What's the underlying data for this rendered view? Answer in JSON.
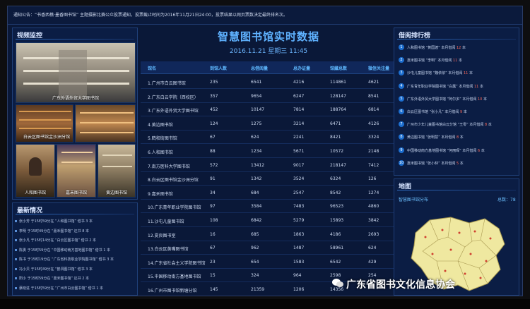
{
  "ticker": "通知公告：“书香西樵·墨香图书馆” 主题摄影比赛公众投票通知，投票截止时间为2016年11月21日24:00，投票结果以网页票数决定最终排名次。",
  "video": {
    "title": "视频监控",
    "tiles": [
      "广东外语外贸大学图书馆",
      "",
      "",
      "白云区图书馆金沙洲分馆",
      "",
      "人和图书馆",
      "嘉禾图书馆",
      "黄边图书馆"
    ]
  },
  "news": {
    "title": "最新情况",
    "items": [
      "张小芳 于15时59分在 “人和图书馆” 借书 3 本",
      "李明 于15时49分在 “嘉禾图书馆” 还书 8 本",
      "张小凡 于15时14分在 “白云区图书馆” 借书 2 本",
      "陈勇 于15时59分在 “中国移动南方基地图书馆” 借书 1 本",
      "陈书 于15时19分在 “广东省科技职业学院图书馆” 借书 3 本",
      "冯小贝 于15时49分在 “鹤洞图书馆” 借书 3 本",
      "阳小 于15时59分在 “嘉禾图书馆” 还书 2 本",
      "蔡晓进 于15时59分在 “广州市白云图书馆” 借书 1 本"
    ]
  },
  "center": {
    "title": "智慧图书馆实时数据",
    "date": "2016.11.21 星期三 11:45",
    "headers": [
      "馆名",
      "到馆人数",
      "总借阅量",
      "总办证量",
      "馆藏总数",
      "微信关注量"
    ],
    "rows": [
      [
        "1.广州市白云图书馆",
        "235",
        "6541",
        "4216",
        "114861",
        "4621"
      ],
      [
        "2.广东白云学院（西校区）",
        "357",
        "9654",
        "6247",
        "128147",
        "8541"
      ],
      [
        "3.广东外语外贸大学图书馆",
        "452",
        "10147",
        "7814",
        "188764",
        "6814"
      ],
      [
        "4.黄边图书馆",
        "124",
        "1275",
        "3214",
        "6471",
        "4126"
      ],
      [
        "5.鹤和街图书馆",
        "67",
        "624",
        "2241",
        "8421",
        "3324"
      ],
      [
        "6.人和图书馆",
        "88",
        "1234",
        "5671",
        "10572",
        "2148"
      ],
      [
        "7.南方医科大学图书馆",
        "572",
        "13412",
        "9017",
        "218147",
        "7412"
      ],
      [
        "8.白云区图书馆金沙洲分馆",
        "91",
        "1342",
        "3524",
        "6324",
        "126"
      ],
      [
        "9.嘉禾图书馆",
        "34",
        "684",
        "2547",
        "8542",
        "1274"
      ],
      [
        "10.广东青年职业学院图书馆",
        "97",
        "3584",
        "7483",
        "96523",
        "4860"
      ],
      [
        "11.沙屯儿童图书馆",
        "108",
        "6842",
        "5279",
        "15893",
        "3842"
      ],
      [
        "12.夏良图书室",
        "16",
        "685",
        "1863",
        "4186",
        "2693"
      ],
      [
        "13.白云区黄嘴图书馆",
        "67",
        "962",
        "1487",
        "58961",
        "624"
      ],
      [
        "14.广东省社会主义学院图书馆",
        "23",
        "654",
        "1583",
        "6542",
        "429"
      ],
      [
        "15.中国移动南方基地图书馆",
        "15",
        "324",
        "964",
        "2598",
        "254"
      ],
      [
        "16.广州市图书馆新塘分馆",
        "145",
        "21359",
        "1206",
        "14356",
        ""
      ]
    ]
  },
  "ranking": {
    "title": "借阅排行榜",
    "items": [
      {
        "n": "1",
        "text": "人和图书馆 “黄国渡” 本月借阅",
        "count": "12",
        "unit": "本"
      },
      {
        "n": "2",
        "text": "嘉禾图书馆 “李明” 本月借阅",
        "count": "11",
        "unit": "本"
      },
      {
        "n": "3",
        "text": "沙屯儿童图书馆 “魏依依” 本月借阅",
        "count": "11",
        "unit": "本"
      },
      {
        "n": "4",
        "text": "广东青年职业学院图书馆 “白露” 本月借阅",
        "count": "11",
        "unit": "本"
      },
      {
        "n": "5",
        "text": "广东外语外贸大学图书馆 “阿尔多” 本月借阅",
        "count": "10",
        "unit": "本"
      },
      {
        "n": "6",
        "text": "白云区图书馆 “张小凡” 本月借阅",
        "count": "9",
        "unit": "本"
      },
      {
        "n": "7",
        "text": "广州市少年儿童图书馆白云分馆 “王零” 本月借阅",
        "count": "8",
        "unit": "本"
      },
      {
        "n": "8",
        "text": "黄边图书馆 “张明慧” 本月借阅",
        "count": "8",
        "unit": "本"
      },
      {
        "n": "9",
        "text": "中国移动南方基地图书馆 “何丽晖” 本月借阅",
        "count": "6",
        "unit": "本"
      },
      {
        "n": "10",
        "text": "嘉禾图书馆 “张小林” 本月借阅",
        "count": "5",
        "unit": "本"
      }
    ]
  },
  "map": {
    "title": "地图",
    "subtitle": "智慧图书馆分布",
    "total": "总数：78"
  },
  "watermark": "广东省图书文化信息协会",
  "colors": {
    "accent": "#5fb2ff",
    "background": "#0a1838",
    "highlight": "#ff6a5a"
  }
}
